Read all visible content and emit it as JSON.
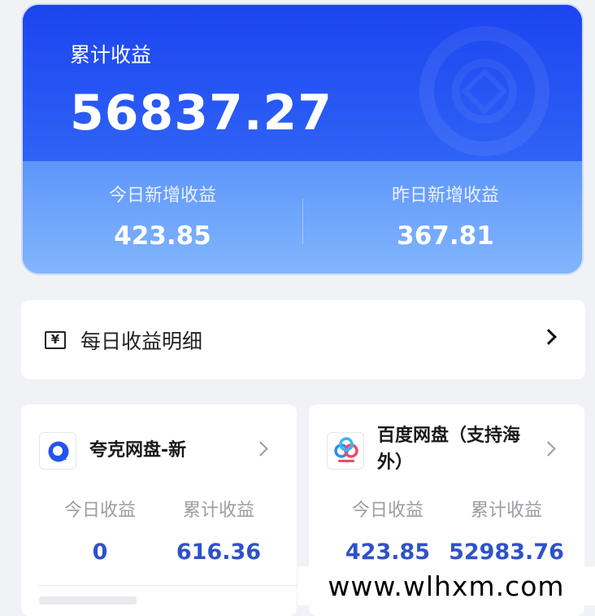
{
  "summary": {
    "total_label": "累计收益",
    "total_value": "56837.27",
    "today_label": "今日新增收益",
    "today_value": "423.85",
    "yesterday_label": "昨日新增收益",
    "yesterday_value": "367.81"
  },
  "daily_detail": {
    "icon_glyph": "¥",
    "label": "每日收益明细"
  },
  "platforms": [
    {
      "name": "夸克网盘-新",
      "today_label": "今日收益",
      "today_value": "0",
      "total_label": "累计收益",
      "total_value": "616.36"
    },
    {
      "name": "百度网盘（支持海外）",
      "today_label": "今日收益",
      "today_value": "423.85",
      "total_label": "累计收益",
      "total_value": "52983.76"
    }
  ],
  "watermark": "www.wlhxm.com",
  "colors": {
    "hero_blue": "#1e49f2",
    "value_blue": "#2f52c9",
    "page_bg": "#f1f2f6"
  }
}
